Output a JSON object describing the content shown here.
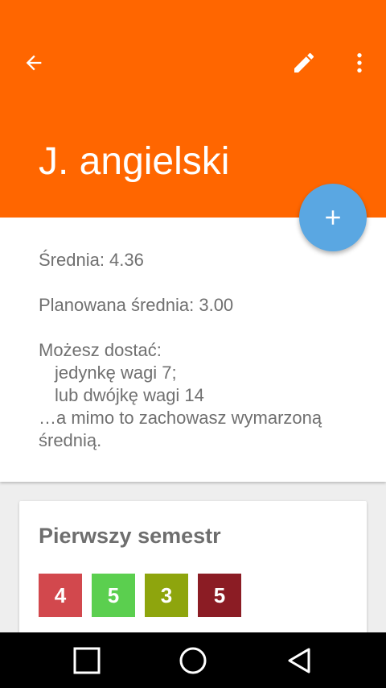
{
  "app_bar": {
    "title": "J. angielski",
    "color": "#ff6600",
    "icons": [
      "arrow-back-icon",
      "edit-pencil-icon",
      "more-vert-icon"
    ]
  },
  "fab": {
    "icon": "add-icon",
    "color": "#5aa7e2"
  },
  "summary": {
    "average": "Średnia: 4.36",
    "planned_average": "Planowana średnia: 3.00",
    "can_get": "Możesz dostać:",
    "option_one": "jedynkę wagi 7;",
    "option_two": "lub dwójkę wagi 14",
    "keep_line1": "…a mimo to zachowasz wymarzoną",
    "keep_line2": "średnią."
  },
  "semester": {
    "title": "Pierwszy semestr",
    "grades": [
      {
        "value": "4",
        "color": "#d2484d"
      },
      {
        "value": "5",
        "color": "#5bcf4f"
      },
      {
        "value": "3",
        "color": "#8ea50d"
      },
      {
        "value": "5",
        "color": "#8b1c24"
      }
    ]
  },
  "system_nav": {
    "icons": [
      "recents-square-icon",
      "home-circle-icon",
      "back-triangle-icon"
    ]
  }
}
